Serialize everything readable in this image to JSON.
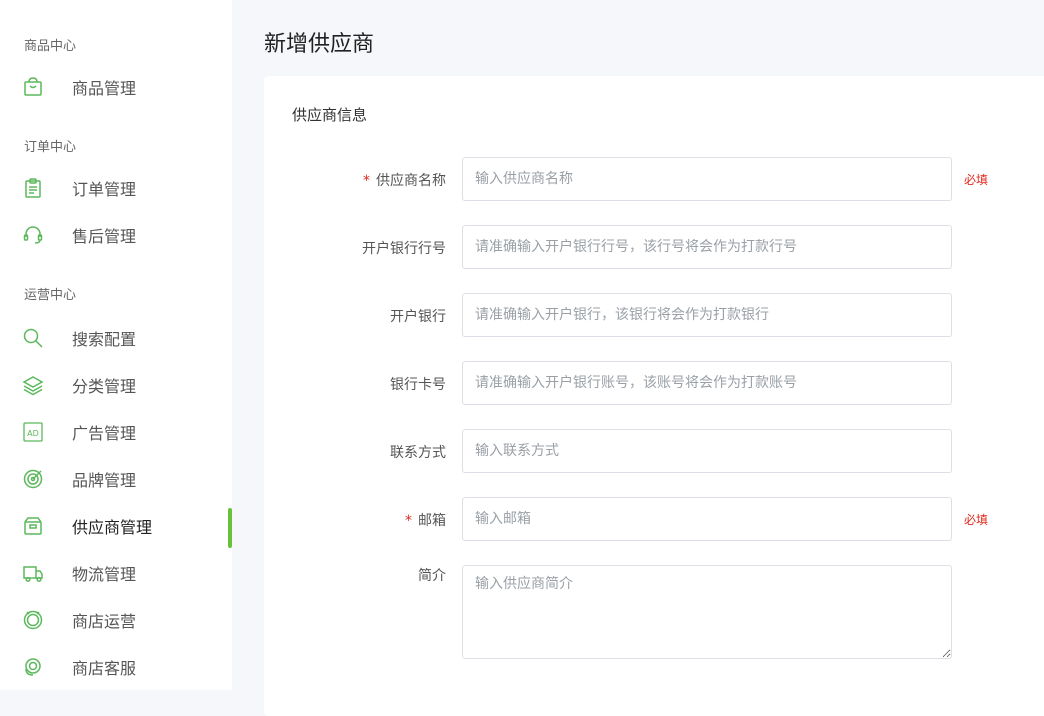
{
  "sidebar": {
    "groups": [
      {
        "title": "商品中心",
        "items": [
          {
            "label": "商品管理",
            "icon": "shopping-bag-icon"
          }
        ]
      },
      {
        "title": "订单中心",
        "items": [
          {
            "label": "订单管理",
            "icon": "clipboard-icon"
          },
          {
            "label": "售后管理",
            "icon": "headset-icon"
          }
        ]
      },
      {
        "title": "运营中心",
        "items": [
          {
            "label": "搜索配置",
            "icon": "search-icon"
          },
          {
            "label": "分类管理",
            "icon": "layers-icon"
          },
          {
            "label": "广告管理",
            "icon": "ad-icon"
          },
          {
            "label": "品牌管理",
            "icon": "target-icon"
          },
          {
            "label": "供应商管理",
            "icon": "box-icon",
            "active": true
          },
          {
            "label": "物流管理",
            "icon": "truck-icon"
          },
          {
            "label": "商店运营",
            "icon": "store-ops-icon"
          },
          {
            "label": "商店客服",
            "icon": "customer-service-icon"
          }
        ]
      }
    ]
  },
  "page_title": "新增供应商",
  "card_title": "供应商信息",
  "form": {
    "fields": [
      {
        "label": "供应商名称",
        "required": true,
        "placeholder": "输入供应商名称",
        "tip": "必填"
      },
      {
        "label": "开户银行行号",
        "required": false,
        "placeholder": "请准确输入开户银行行号，该行号将会作为打款行号"
      },
      {
        "label": "开户银行",
        "required": false,
        "placeholder": "请准确输入开户银行，该银行将会作为打款银行"
      },
      {
        "label": "银行卡号",
        "required": false,
        "placeholder": "请准确输入开户银行账号，该账号将会作为打款账号"
      },
      {
        "label": "联系方式",
        "required": false,
        "placeholder": "输入联系方式"
      },
      {
        "label": "邮箱",
        "required": true,
        "placeholder": "输入邮箱",
        "tip": "必填"
      },
      {
        "label": "简介",
        "required": false,
        "placeholder": "输入供应商简介"
      }
    ],
    "required_mark": "*"
  },
  "colors": {
    "accent": "#67c23a",
    "icon": "#5cb85c",
    "required": "#e0281c"
  }
}
